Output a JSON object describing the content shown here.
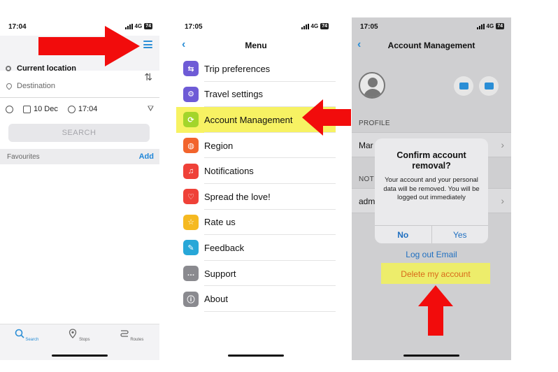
{
  "status": {
    "time_1": "17:04",
    "time_2": "17:05",
    "time_3": "17:05",
    "network": "4G",
    "battery": "74"
  },
  "screen1": {
    "current_location": "Current location",
    "destination": "Destination",
    "date": "10 Dec",
    "time": "17:04",
    "search_label": "SEARCH",
    "favourites_label": "Favourites",
    "add_label": "Add",
    "tabs": [
      {
        "label": "Search",
        "icon": "search-icon"
      },
      {
        "label": "Stops",
        "icon": "pin-icon"
      },
      {
        "label": "Routes",
        "icon": "route-icon"
      }
    ]
  },
  "screen2": {
    "title": "Menu",
    "items": [
      {
        "label": "Trip preferences",
        "icon": "trip-icon",
        "color": "#6e5bd6"
      },
      {
        "label": "Travel settings",
        "icon": "gear-icon",
        "color": "#6e5bd6"
      },
      {
        "label": "Account Management",
        "icon": "refresh-icon",
        "color": "#a3d52b"
      },
      {
        "label": "Region",
        "icon": "globe-icon",
        "color": "#f2642c"
      },
      {
        "label": "Notifications",
        "icon": "bell-icon",
        "color": "#ef4138"
      },
      {
        "label": "Spread the love!",
        "icon": "heart-icon",
        "color": "#ef4138"
      },
      {
        "label": "Rate us",
        "icon": "star-icon",
        "color": "#f5b921"
      },
      {
        "label": "Feedback",
        "icon": "feedback-icon",
        "color": "#27a7d8"
      },
      {
        "label": "Support",
        "icon": "chat-icon",
        "color": "#8a8a8f"
      },
      {
        "label": "About",
        "icon": "info-icon",
        "color": "#8a8a8f"
      }
    ]
  },
  "screen3": {
    "title": "Account Management",
    "profile_header": "PROFILE",
    "profile_row": "Mar",
    "notif_header": "NOT",
    "admin_row": "adm",
    "logout_label": "Log out Email",
    "delete_label": "Delete my account",
    "dialog": {
      "title": "Confirm account removal?",
      "message": "Your account and your personal data will be removed. You will be logged out immediately",
      "no_label": "No",
      "yes_label": "Yes"
    }
  },
  "colors": {
    "accent": "#2a8ed6",
    "highlight": "#f7f263",
    "arrow": "#f20c0c"
  }
}
